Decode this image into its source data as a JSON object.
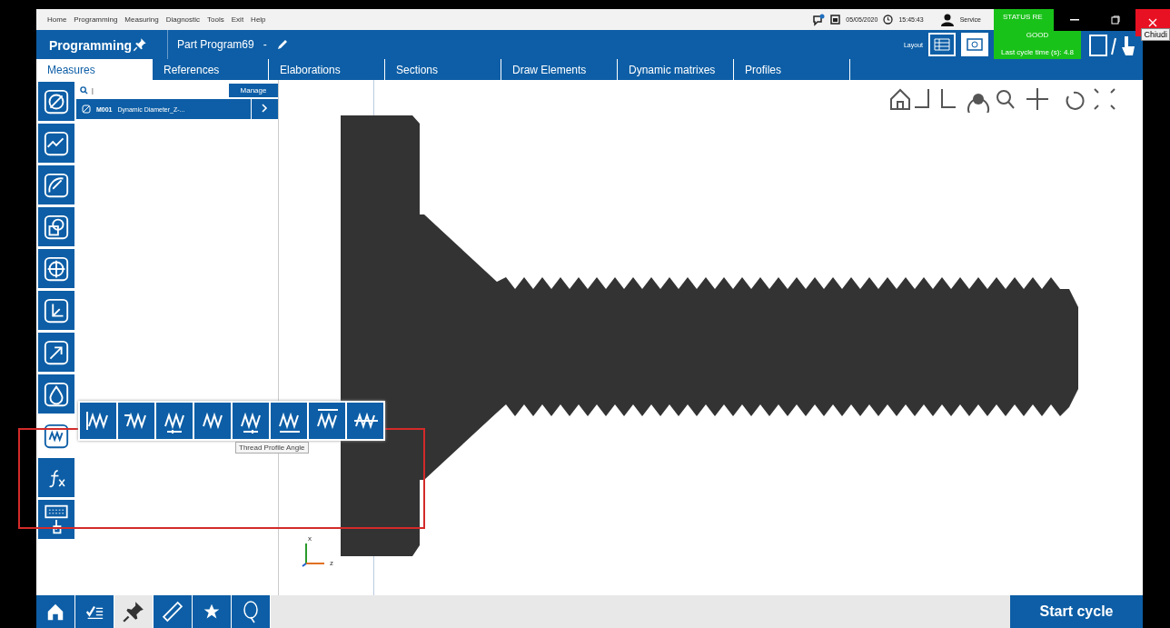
{
  "menu_bar": [
    "Home",
    "Programming",
    "Measuring",
    "Diagnostic",
    "Tools",
    "Exit",
    "Help"
  ],
  "status": {
    "date": "05/05/2020",
    "time": "15:45:43",
    "user": "Service"
  },
  "header": {
    "section": "Programming",
    "program": "Part Program69",
    "separator": "-",
    "layout_label": "Layout"
  },
  "machine_status": {
    "title": "STATUS RE",
    "result": "GOOD",
    "cycle_time": "Last cycle time (s): 4.8"
  },
  "window_controls": {
    "tooltip": "Chiudi"
  },
  "tabs": [
    {
      "label": "Measures",
      "selected": true
    },
    {
      "label": "References",
      "selected": false
    },
    {
      "label": "Elaborations",
      "selected": false
    },
    {
      "label": "Sections",
      "selected": false
    },
    {
      "label": "Draw Elements",
      "selected": false
    },
    {
      "label": "Dynamic matrixes",
      "selected": false
    },
    {
      "label": "Profiles",
      "selected": false
    }
  ],
  "measure_tools": [
    {
      "kind": "diameter",
      "selected": false
    },
    {
      "kind": "profile",
      "selected": false
    },
    {
      "kind": "arc",
      "selected": false
    },
    {
      "kind": "shapes",
      "selected": false
    },
    {
      "kind": "center",
      "selected": false
    },
    {
      "kind": "axes",
      "selected": false
    },
    {
      "kind": "vector",
      "selected": false
    },
    {
      "kind": "drop",
      "selected": false
    },
    {
      "kind": "thread",
      "selected": true
    },
    {
      "kind": "formula",
      "selected": false
    },
    {
      "kind": "keyboard",
      "selected": false
    }
  ],
  "thread_tools": {
    "items": [
      {
        "kind": "pitch"
      },
      {
        "kind": "depth"
      },
      {
        "kind": "flank"
      },
      {
        "kind": "wave"
      },
      {
        "kind": "angle"
      },
      {
        "kind": "coil"
      },
      {
        "kind": "major"
      },
      {
        "kind": "minor"
      }
    ],
    "tooltip": "Thread Profile Angle"
  },
  "search": {
    "value": "|",
    "button": "Manage"
  },
  "measures": [
    {
      "code": "M001",
      "name": "Dynamic Diameter_Z-..."
    }
  ],
  "axes": {
    "x": "x",
    "z": "z"
  },
  "bottom_nav": [
    {
      "kind": "home",
      "selected": false
    },
    {
      "kind": "checklist",
      "selected": false
    },
    {
      "kind": "pin",
      "selected": true
    },
    {
      "kind": "ruler",
      "selected": false
    },
    {
      "kind": "star",
      "selected": false
    },
    {
      "kind": "q",
      "selected": false
    }
  ],
  "start_button": "Start cycle"
}
